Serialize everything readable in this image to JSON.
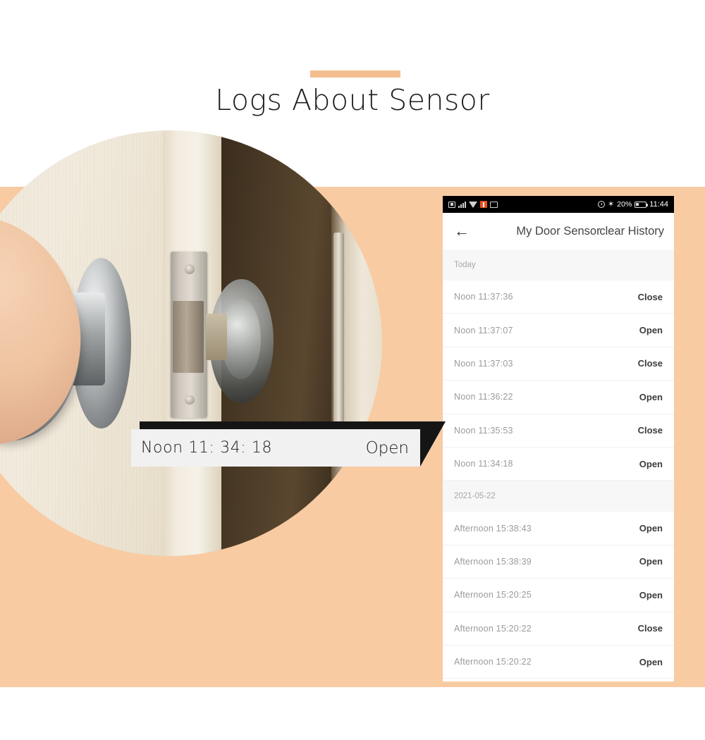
{
  "header": {
    "title": "Logs About Sensor",
    "accent_color": "#f4bd90"
  },
  "photo": {
    "alt": "hand-opening-door-knob"
  },
  "callout": {
    "time": "Noon 11: 34: 18",
    "state": "Open"
  },
  "phone": {
    "statusbar": {
      "icons_left": [
        "sim-icon",
        "signal-icon",
        "wifi-icon",
        "alert-icon",
        "sd-card-icon"
      ],
      "alarm_icon": "alarm-clock-icon",
      "bluetooth_icon": "bluetooth-icon",
      "battery_percent": "20%",
      "battery_icon": "battery-icon",
      "time": "11:44"
    },
    "appbar": {
      "back_icon": "back-arrow-icon",
      "title": "My Door Sensor",
      "action": "clear History"
    },
    "groups": [
      {
        "label": "Today",
        "rows": [
          {
            "time": "Noon  11:37:36",
            "state": "Close"
          },
          {
            "time": "Noon  11:37:07",
            "state": "Open"
          },
          {
            "time": "Noon  11:37:03",
            "state": "Close"
          },
          {
            "time": "Noon  11:36:22",
            "state": "Open"
          },
          {
            "time": "Noon  11:35:53",
            "state": "Close"
          },
          {
            "time": "Noon  11:34:18",
            "state": "Open"
          }
        ]
      },
      {
        "label": "2021-05-22",
        "rows": [
          {
            "time": "Afternoon  15:38:43",
            "state": "Open"
          },
          {
            "time": "Afternoon  15:38:39",
            "state": "Open"
          },
          {
            "time": "Afternoon  15:20:25",
            "state": "Open"
          },
          {
            "time": "Afternoon  15:20:22",
            "state": "Close"
          },
          {
            "time": "Afternoon  15:20:22",
            "state": "Open"
          }
        ]
      }
    ]
  },
  "colors": {
    "background": "#ffffff",
    "band": "#f8cba3",
    "accent": "#f4bd90",
    "callout_bar": "#151515",
    "callout_body": "#f1f1f1"
  }
}
